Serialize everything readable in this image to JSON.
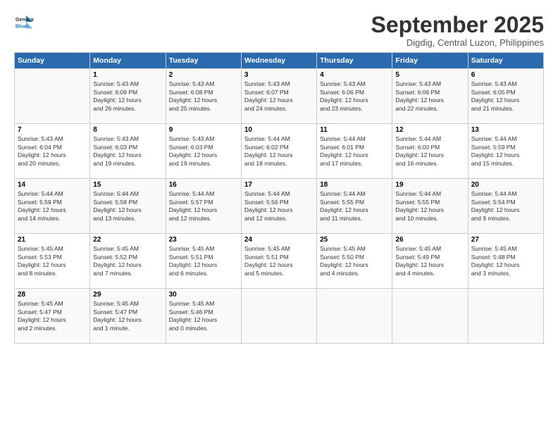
{
  "header": {
    "logo_line1": "General",
    "logo_line2": "Blue",
    "title": "September 2025",
    "subtitle": "Digdig, Central Luzon, Philippines"
  },
  "columns": [
    "Sunday",
    "Monday",
    "Tuesday",
    "Wednesday",
    "Thursday",
    "Friday",
    "Saturday"
  ],
  "weeks": [
    [
      {
        "day": "",
        "text": ""
      },
      {
        "day": "1",
        "text": "Sunrise: 5:43 AM\nSunset: 6:09 PM\nDaylight: 12 hours\nand 26 minutes."
      },
      {
        "day": "2",
        "text": "Sunrise: 5:43 AM\nSunset: 6:08 PM\nDaylight: 12 hours\nand 25 minutes."
      },
      {
        "day": "3",
        "text": "Sunrise: 5:43 AM\nSunset: 6:07 PM\nDaylight: 12 hours\nand 24 minutes."
      },
      {
        "day": "4",
        "text": "Sunrise: 5:43 AM\nSunset: 6:06 PM\nDaylight: 12 hours\nand 23 minutes."
      },
      {
        "day": "5",
        "text": "Sunrise: 5:43 AM\nSunset: 6:06 PM\nDaylight: 12 hours\nand 22 minutes."
      },
      {
        "day": "6",
        "text": "Sunrise: 5:43 AM\nSunset: 6:05 PM\nDaylight: 12 hours\nand 21 minutes."
      }
    ],
    [
      {
        "day": "7",
        "text": "Sunrise: 5:43 AM\nSunset: 6:04 PM\nDaylight: 12 hours\nand 20 minutes."
      },
      {
        "day": "8",
        "text": "Sunrise: 5:43 AM\nSunset: 6:03 PM\nDaylight: 12 hours\nand 19 minutes."
      },
      {
        "day": "9",
        "text": "Sunrise: 5:43 AM\nSunset: 6:03 PM\nDaylight: 12 hours\nand 19 minutes."
      },
      {
        "day": "10",
        "text": "Sunrise: 5:44 AM\nSunset: 6:02 PM\nDaylight: 12 hours\nand 18 minutes."
      },
      {
        "day": "11",
        "text": "Sunrise: 5:44 AM\nSunset: 6:01 PM\nDaylight: 12 hours\nand 17 minutes."
      },
      {
        "day": "12",
        "text": "Sunrise: 5:44 AM\nSunset: 6:00 PM\nDaylight: 12 hours\nand 16 minutes."
      },
      {
        "day": "13",
        "text": "Sunrise: 5:44 AM\nSunset: 5:59 PM\nDaylight: 12 hours\nand 15 minutes."
      }
    ],
    [
      {
        "day": "14",
        "text": "Sunrise: 5:44 AM\nSunset: 5:59 PM\nDaylight: 12 hours\nand 14 minutes."
      },
      {
        "day": "15",
        "text": "Sunrise: 5:44 AM\nSunset: 5:58 PM\nDaylight: 12 hours\nand 13 minutes."
      },
      {
        "day": "16",
        "text": "Sunrise: 5:44 AM\nSunset: 5:57 PM\nDaylight: 12 hours\nand 12 minutes."
      },
      {
        "day": "17",
        "text": "Sunrise: 5:44 AM\nSunset: 5:56 PM\nDaylight: 12 hours\nand 12 minutes."
      },
      {
        "day": "18",
        "text": "Sunrise: 5:44 AM\nSunset: 5:55 PM\nDaylight: 12 hours\nand 11 minutes."
      },
      {
        "day": "19",
        "text": "Sunrise: 5:44 AM\nSunset: 5:55 PM\nDaylight: 12 hours\nand 10 minutes."
      },
      {
        "day": "20",
        "text": "Sunrise: 5:44 AM\nSunset: 5:54 PM\nDaylight: 12 hours\nand 9 minutes."
      }
    ],
    [
      {
        "day": "21",
        "text": "Sunrise: 5:45 AM\nSunset: 5:53 PM\nDaylight: 12 hours\nand 8 minutes."
      },
      {
        "day": "22",
        "text": "Sunrise: 5:45 AM\nSunset: 5:52 PM\nDaylight: 12 hours\nand 7 minutes."
      },
      {
        "day": "23",
        "text": "Sunrise: 5:45 AM\nSunset: 5:51 PM\nDaylight: 12 hours\nand 6 minutes."
      },
      {
        "day": "24",
        "text": "Sunrise: 5:45 AM\nSunset: 5:51 PM\nDaylight: 12 hours\nand 5 minutes."
      },
      {
        "day": "25",
        "text": "Sunrise: 5:45 AM\nSunset: 5:50 PM\nDaylight: 12 hours\nand 4 minutes."
      },
      {
        "day": "26",
        "text": "Sunrise: 5:45 AM\nSunset: 5:49 PM\nDaylight: 12 hours\nand 4 minutes."
      },
      {
        "day": "27",
        "text": "Sunrise: 5:45 AM\nSunset: 5:48 PM\nDaylight: 12 hours\nand 3 minutes."
      }
    ],
    [
      {
        "day": "28",
        "text": "Sunrise: 5:45 AM\nSunset: 5:47 PM\nDaylight: 12 hours\nand 2 minutes."
      },
      {
        "day": "29",
        "text": "Sunrise: 5:45 AM\nSunset: 5:47 PM\nDaylight: 12 hours\nand 1 minute."
      },
      {
        "day": "30",
        "text": "Sunrise: 5:45 AM\nSunset: 5:46 PM\nDaylight: 12 hours\nand 0 minutes."
      },
      {
        "day": "",
        "text": ""
      },
      {
        "day": "",
        "text": ""
      },
      {
        "day": "",
        "text": ""
      },
      {
        "day": "",
        "text": ""
      }
    ]
  ]
}
